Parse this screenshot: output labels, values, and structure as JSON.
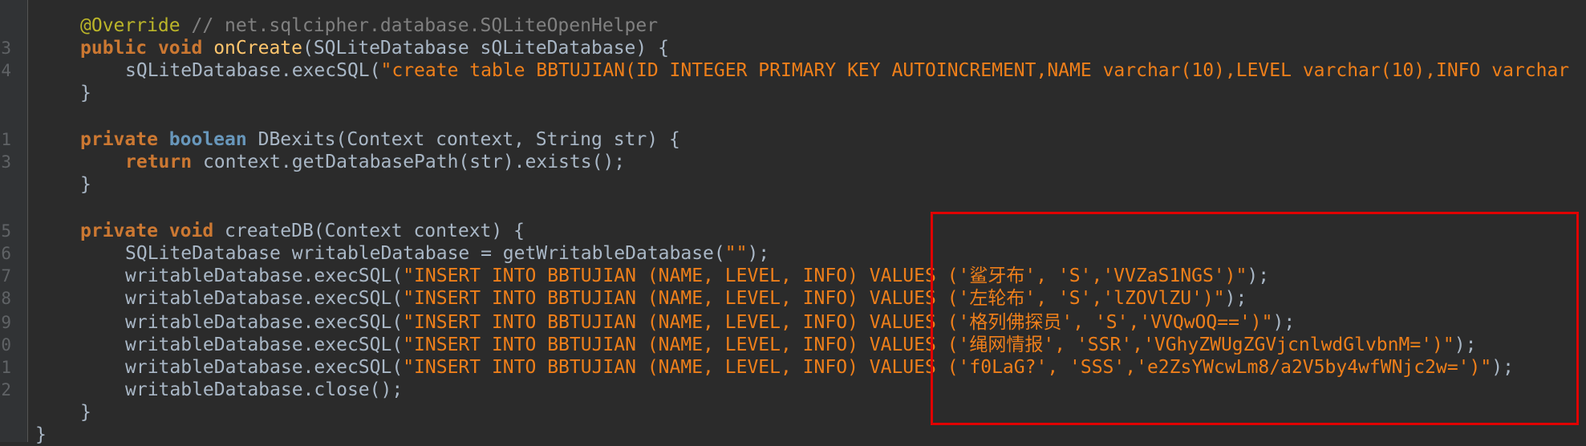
{
  "line_numbers": [
    "",
    "3",
    "4",
    "",
    "",
    "1",
    "3",
    "",
    "",
    "5",
    "6",
    "7",
    "8",
    "9",
    "0",
    "1",
    "2",
    "",
    ""
  ],
  "lines": {
    "l1": {
      "ann": "@Override",
      "cmt": " // net.sqlcipher.database.SQLiteOpenHelper"
    },
    "l2": {
      "kw1": "public",
      "kw2": "void",
      "fn": "onCreate",
      "rest": "(SQLiteDatabase sQLiteDatabase) {"
    },
    "l3": {
      "pre": "sQLiteDatabase.execSQL(",
      "str": "\"create table BBTUJIAN(ID INTEGER PRIMARY KEY AUTOINCREMENT,NAME varchar(10),LEVEL varchar(10),INFO varchar"
    },
    "l4": {
      "text": "}"
    },
    "l5": {
      "kw1": "private",
      "kw2": "boolean",
      "fn": "DBexits",
      "rest": "(Context context, String str) {"
    },
    "l6": {
      "kw": "return",
      "rest": " context.getDatabasePath(str).exists();"
    },
    "l7": {
      "text": "}"
    },
    "l8": {
      "kw1": "private",
      "kw2": "void",
      "fn": "createDB",
      "rest": "(Context context) {"
    },
    "l9": {
      "pre": "SQLiteDatabase writableDatabase = getWritableDatabase(",
      "str": "\"\"",
      "post": ");"
    },
    "l10": {
      "pre": "writableDatabase.execSQL(",
      "str": "\"INSERT INTO BBTUJIAN (NAME, LEVEL, INFO) VALUES ('鲨牙布', 'S','VVZaS1NGS')\"",
      "post": ");"
    },
    "l11": {
      "pre": "writableDatabase.execSQL(",
      "str": "\"INSERT INTO BBTUJIAN (NAME, LEVEL, INFO) VALUES ('左轮布', 'S','lZOVlZU')\"",
      "post": ");"
    },
    "l12": {
      "pre": "writableDatabase.execSQL(",
      "str": "\"INSERT INTO BBTUJIAN (NAME, LEVEL, INFO) VALUES ('格列佛探员', 'S','VVQwOQ==')\"",
      "post": ");"
    },
    "l13": {
      "pre": "writableDatabase.execSQL(",
      "str": "\"INSERT INTO BBTUJIAN (NAME, LEVEL, INFO) VALUES ('绳网情报', 'SSR','VGhyZWUgZGVjcnlwdGlvbnM=')\"",
      "post": ");"
    },
    "l14": {
      "pre": "writableDatabase.execSQL(",
      "str": "\"INSERT INTO BBTUJIAN (NAME, LEVEL, INFO) VALUES ('f0LaG?', 'SSS','e2ZsYWcwLm8/a2V5by4wfWNjc2w=')\"",
      "post": ");"
    },
    "l15": {
      "text": "writableDatabase.close();"
    },
    "l16": {
      "text": "}"
    },
    "l17": {
      "text": "}"
    }
  },
  "colors": {
    "background": "#2b2b2b",
    "keyword": "#cc7832",
    "string": "#ef7f1a",
    "method": "#ffc66d",
    "highlight_box": "#e00000"
  }
}
